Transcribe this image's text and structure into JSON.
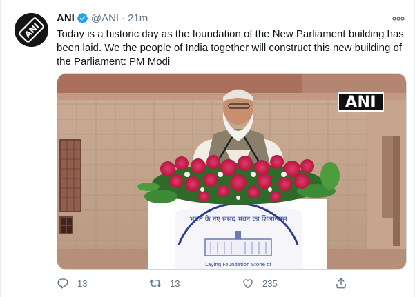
{
  "author": {
    "name": "ANI",
    "handle": "@ANI",
    "separator": "·",
    "time": "21m",
    "avatar_text": "ANI"
  },
  "tweet": {
    "text": "Today is a historic day as the foundation of the New Parliament building has been laid. We the people of India together will construct this new building of the Parliament: PM Modi"
  },
  "media": {
    "watermark": "ANI",
    "podium_text_top": "भारत के नए संसद भवन का शिलान्यास",
    "podium_text_bottom": "Laying Foundation Stone of"
  },
  "actions": {
    "reply_count": "13",
    "retweet_count": "13",
    "like_count": "235"
  },
  "icons": {
    "verified": "verified-badge-icon",
    "more": "more-options-icon",
    "reply": "reply-icon",
    "retweet": "retweet-icon",
    "like": "like-icon",
    "share": "share-icon"
  },
  "colors": {
    "verified_blue": "#1da1f2",
    "secondary_text": "#5b7083",
    "primary_text": "#0f1419"
  }
}
